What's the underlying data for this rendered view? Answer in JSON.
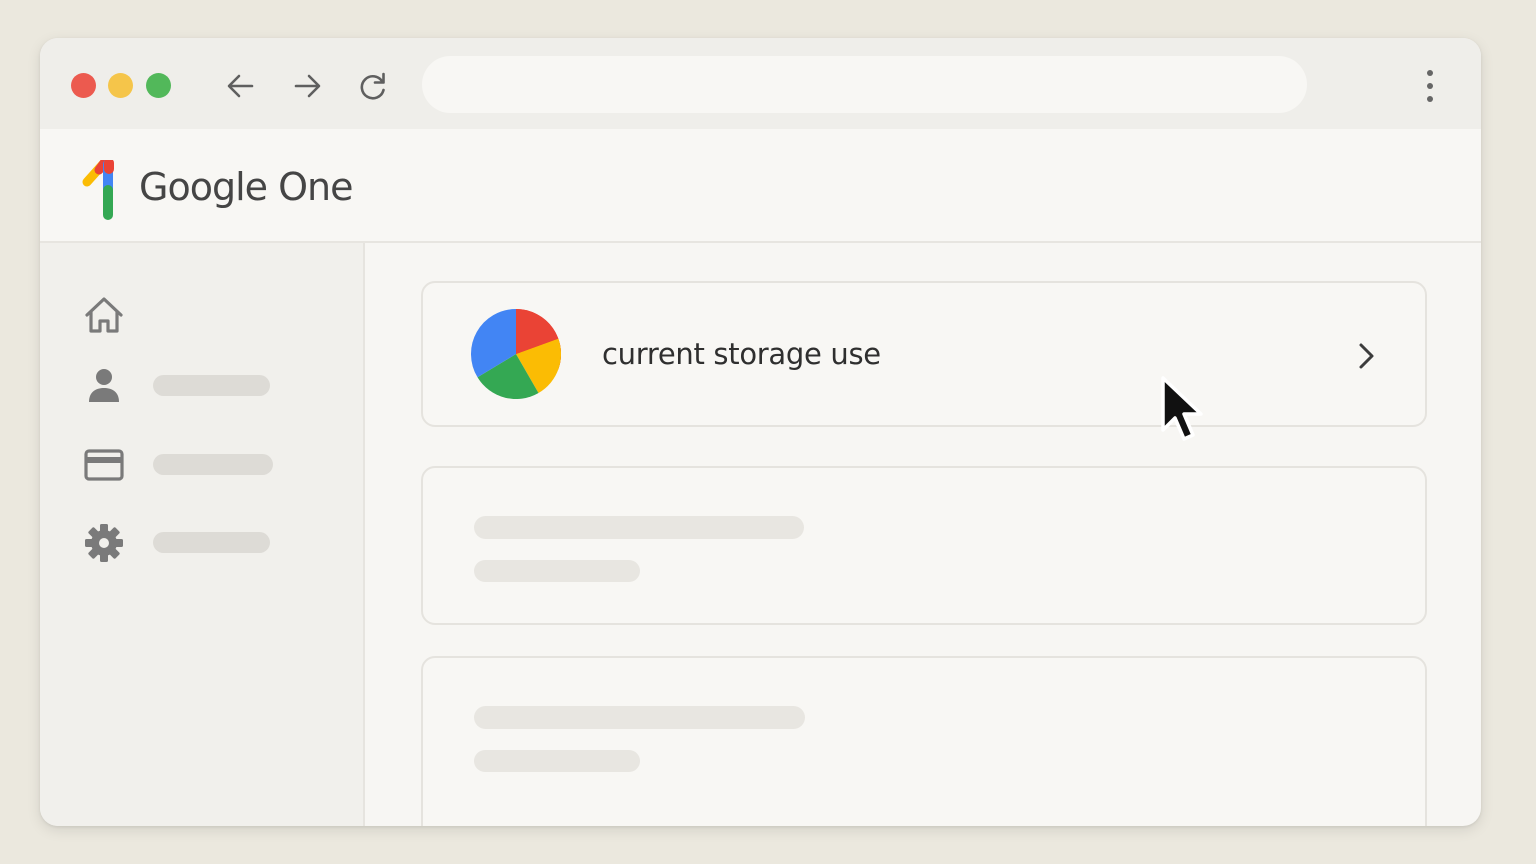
{
  "browser": {
    "address_value": "",
    "icons": [
      "arrow-left-icon",
      "arrow-right-icon",
      "reload-icon",
      "more-vertical-icon"
    ],
    "window_controls": {
      "close": "#ec5a4f",
      "minimize": "#f5c54a",
      "maximize": "#52b85a"
    }
  },
  "app": {
    "logo_text": "Google One",
    "brand_colors": {
      "blue": "#4285f4",
      "red": "#ea4335",
      "yellow": "#fbbc04",
      "green": "#34a853"
    }
  },
  "sidebar": {
    "items": [
      {
        "icon": "home-icon"
      },
      {
        "icon": "person-icon"
      },
      {
        "icon": "credit-card-icon"
      },
      {
        "icon": "gear-icon"
      }
    ]
  },
  "main": {
    "storage_card": {
      "label": "current storage use",
      "icon": "pie-chart-icon",
      "action_icon": "chevron-right-icon"
    }
  }
}
